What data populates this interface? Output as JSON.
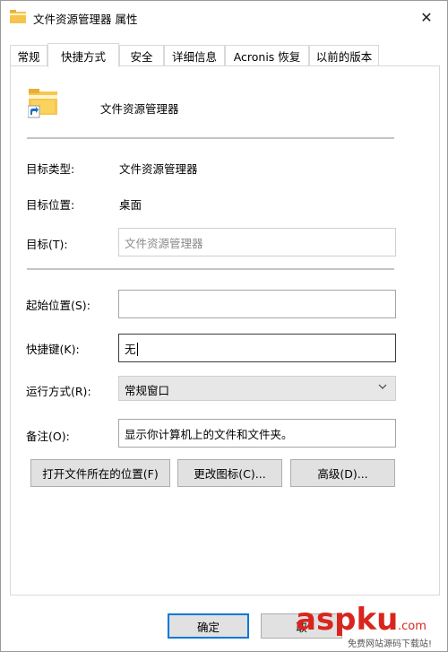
{
  "window": {
    "title": "文件资源管理器 属性",
    "close_glyph": "✕"
  },
  "tabs": [
    {
      "label": "常规"
    },
    {
      "label": "快捷方式"
    },
    {
      "label": "安全"
    },
    {
      "label": "详细信息"
    },
    {
      "label": "Acronis 恢复"
    },
    {
      "label": "以前的版本"
    }
  ],
  "active_tab": "快捷方式",
  "header": {
    "name": "文件资源管理器"
  },
  "info": {
    "target_type_label": "目标类型:",
    "target_type_value": "文件资源管理器",
    "target_location_label": "目标位置:",
    "target_location_value": "桌面",
    "target_label": "目标(T):",
    "target_value": "文件资源管理器"
  },
  "fields": {
    "start_in_label": "起始位置(S):",
    "start_in_value": "",
    "shortcut_key_label": "快捷键(K):",
    "shortcut_key_value": "无",
    "run_label": "运行方式(R):",
    "run_value": "常规窗口",
    "comment_label": "备注(O):",
    "comment_value": "显示你计算机上的文件和文件夹。"
  },
  "buttons": {
    "open_location": "打开文件所在的位置(F)",
    "change_icon": "更改图标(C)...",
    "advanced": "高级(D)..."
  },
  "footer": {
    "ok": "确定",
    "cancel_partial": "取"
  },
  "watermark": {
    "brand": "aspku",
    "suffix": ".com",
    "tagline": "免费网站源码下载站!"
  },
  "colors": {
    "accent": "#0078d7",
    "watermark_red": "#d8261e"
  },
  "icons": {
    "app": "folder-shortcut-icon",
    "close": "close-icon",
    "dropdown": "chevron-down-icon"
  }
}
